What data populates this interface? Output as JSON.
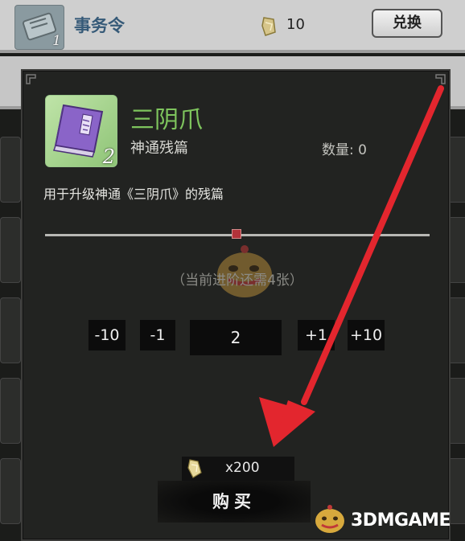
{
  "background_row": {
    "name": "事务令",
    "badge": "1",
    "price": "10",
    "exchange_label": "兑换"
  },
  "item": {
    "name": "三阴爪",
    "type": "神通残篇",
    "count_badge": "2",
    "quantity_text": "数量: 0",
    "description": "用于升级神通《三阴爪》的残篇",
    "need_text": "（当前进阶还需4张）"
  },
  "stepper": {
    "minus10": "-10",
    "minus1": "-1",
    "value": "2",
    "plus1": "+1",
    "plus10": "+10"
  },
  "purchase": {
    "cost": "x200",
    "buy_label": "购买"
  },
  "watermark": {
    "text": "3DMGAME"
  },
  "colors": {
    "title_green": "#7ec45d",
    "arrow_red": "#e3262e",
    "dialog_bg": "#222321"
  }
}
